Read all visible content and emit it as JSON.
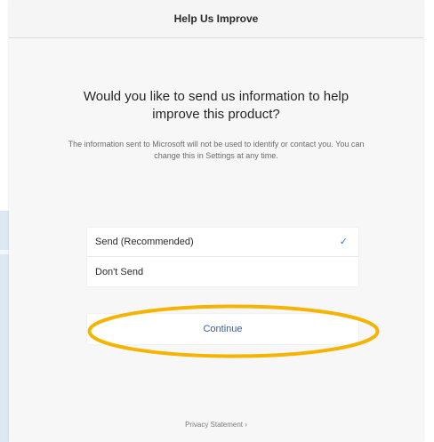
{
  "dialog": {
    "title": "Help Us Improve",
    "question": "Would you like to send us information to help improve this product?",
    "description": "The information sent to Microsoft will not be used to identify or contact you. You can change this in Settings at any time.",
    "options": [
      {
        "label": "Send (Recommended)",
        "selected": true
      },
      {
        "label": "Don't Send",
        "selected": false
      }
    ],
    "check_mark": "✓",
    "continue_label": "Continue",
    "privacy_label": "Privacy Statement ›"
  },
  "colors": {
    "highlight": "#f4b400",
    "link": "#2d5fa8",
    "check": "#3b73c7"
  },
  "icons": {
    "selected_indicator": "checkmark-icon",
    "privacy_chevron": "chevron-right-icon"
  }
}
